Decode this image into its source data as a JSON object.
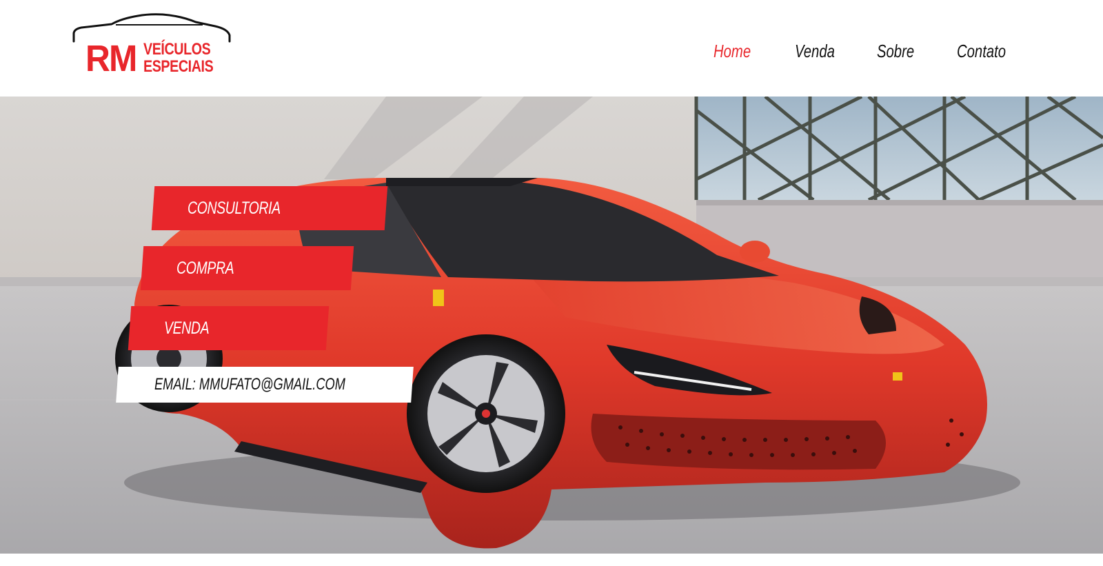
{
  "header": {
    "logo": {
      "rm": "RM",
      "line1": "VEÍCULOS",
      "line2": "ESPECIAIS"
    },
    "nav": [
      {
        "label": "Home",
        "active": true
      },
      {
        "label": "Venda",
        "active": false
      },
      {
        "label": "Sobre",
        "active": false
      },
      {
        "label": "Contato",
        "active": false
      }
    ]
  },
  "hero": {
    "tags": [
      {
        "label": "CONSULTORIA"
      },
      {
        "label": "COMPRA"
      },
      {
        "label": "VENDA"
      }
    ],
    "email_label": "EMAIL: MMUFATO@GMAIL.COM"
  },
  "colors": {
    "accent": "#e8262b",
    "text": "#111111",
    "background": "#ffffff"
  },
  "icons": [
    "car-outline-icon"
  ]
}
